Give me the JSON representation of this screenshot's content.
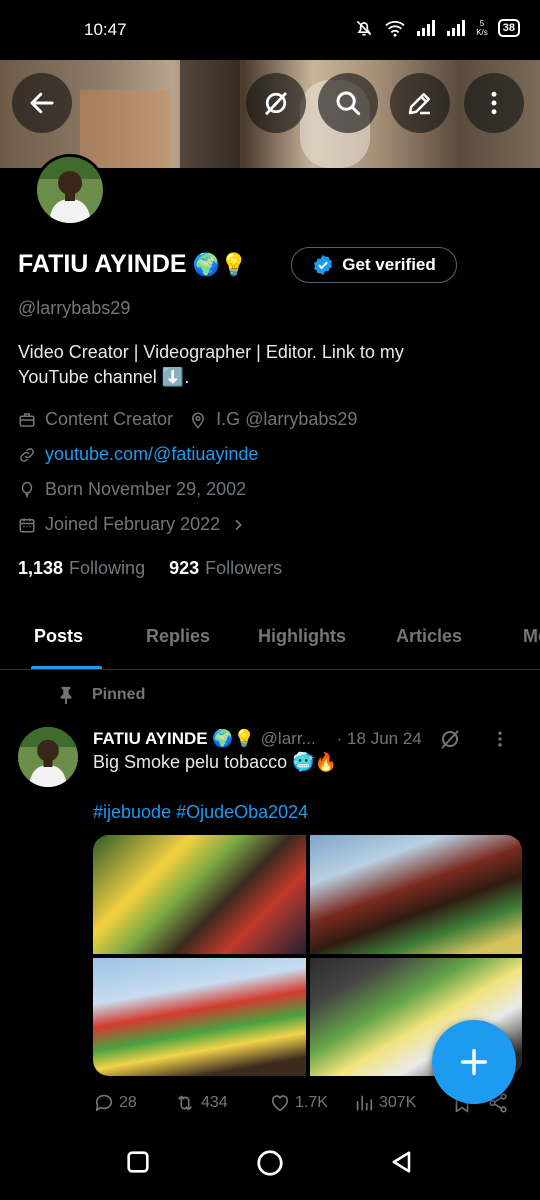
{
  "status_bar": {
    "time": "10:47",
    "speed_top": "5",
    "speed_bottom": "K/s",
    "battery": "38"
  },
  "header": {
    "buttons": [
      {
        "icon": "back-arrow-icon"
      },
      {
        "icon": "grok-icon"
      },
      {
        "icon": "search-icon"
      },
      {
        "icon": "edit-icon"
      },
      {
        "icon": "more-vertical-icon"
      }
    ]
  },
  "profile": {
    "name": "FATIU AYINDE",
    "name_emojis": "🌍💡",
    "get_verified_label": "Get verified",
    "handle": "@larrybabs29",
    "bio_line1": "Video Creator | Videographer | Editor.  Link to my",
    "bio_line2": "YouTube channel ⬇️.",
    "category": "Content Creator",
    "location": "I.G @larrybabs29",
    "website": "youtube.com/@fatiuayinde",
    "born": "Born November 29, 2002",
    "joined": "Joined February 2022",
    "following_count": "1,138",
    "following_label": "Following",
    "followers_count": "923",
    "followers_label": "Followers"
  },
  "tabs": [
    "Posts",
    "Replies",
    "Highlights",
    "Articles",
    "Media"
  ],
  "active_tab": "Posts",
  "post": {
    "pinned_label": "Pinned",
    "author_name": "FATIU AYINDE 🌍💡",
    "author_handle": "@larr...",
    "date": "· 18 Jun 24",
    "text": "Big Smoke pelu tobacco 🥶🔥",
    "hashtags": "#ijebuode #OjudeOba2024",
    "replies": "28",
    "reposts": "434",
    "likes": "1.7K",
    "views": "307K"
  },
  "colors": {
    "accent": "#1d9bf0",
    "muted": "#71767b",
    "background": "#000000"
  }
}
